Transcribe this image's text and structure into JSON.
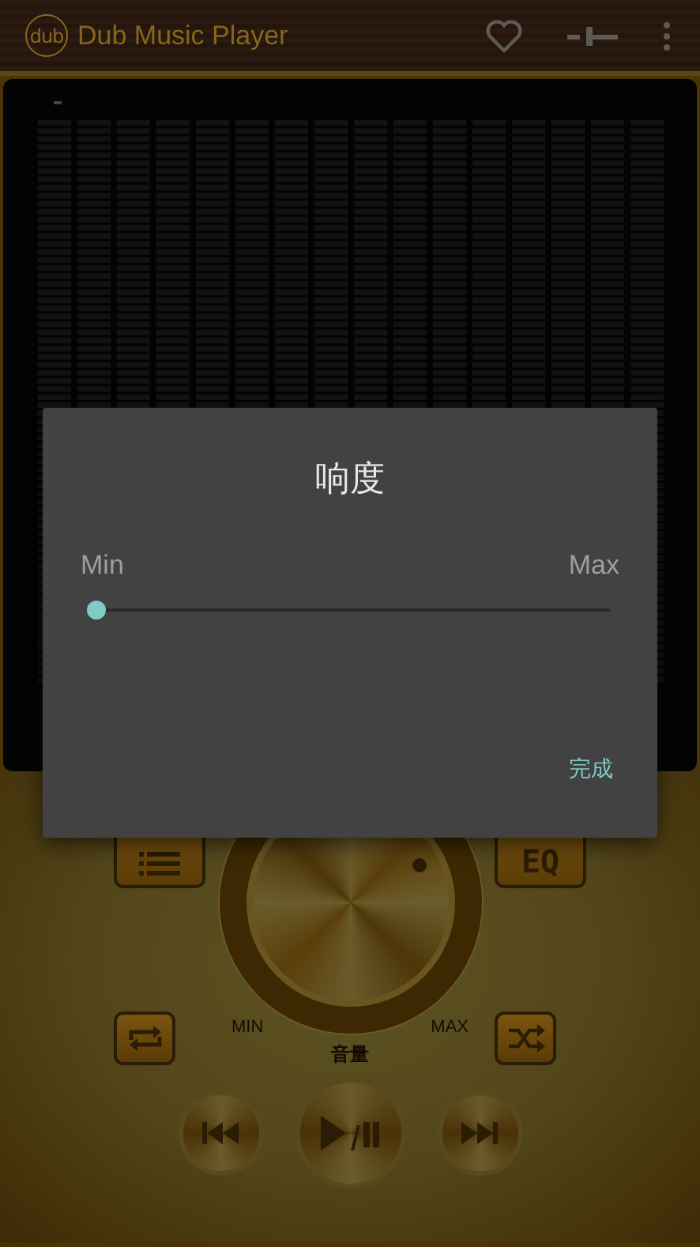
{
  "app": {
    "logo": "dub",
    "title": "Dub Music Player"
  },
  "dialog": {
    "title": "响度",
    "min_label": "Min",
    "max_label": "Max",
    "slider": {
      "level": 0
    },
    "button": "完成"
  },
  "controls": {
    "eq_button": "EQ",
    "knob": {
      "min_label": "MIN",
      "max_label": "MAX",
      "caption": "音量"
    }
  }
}
